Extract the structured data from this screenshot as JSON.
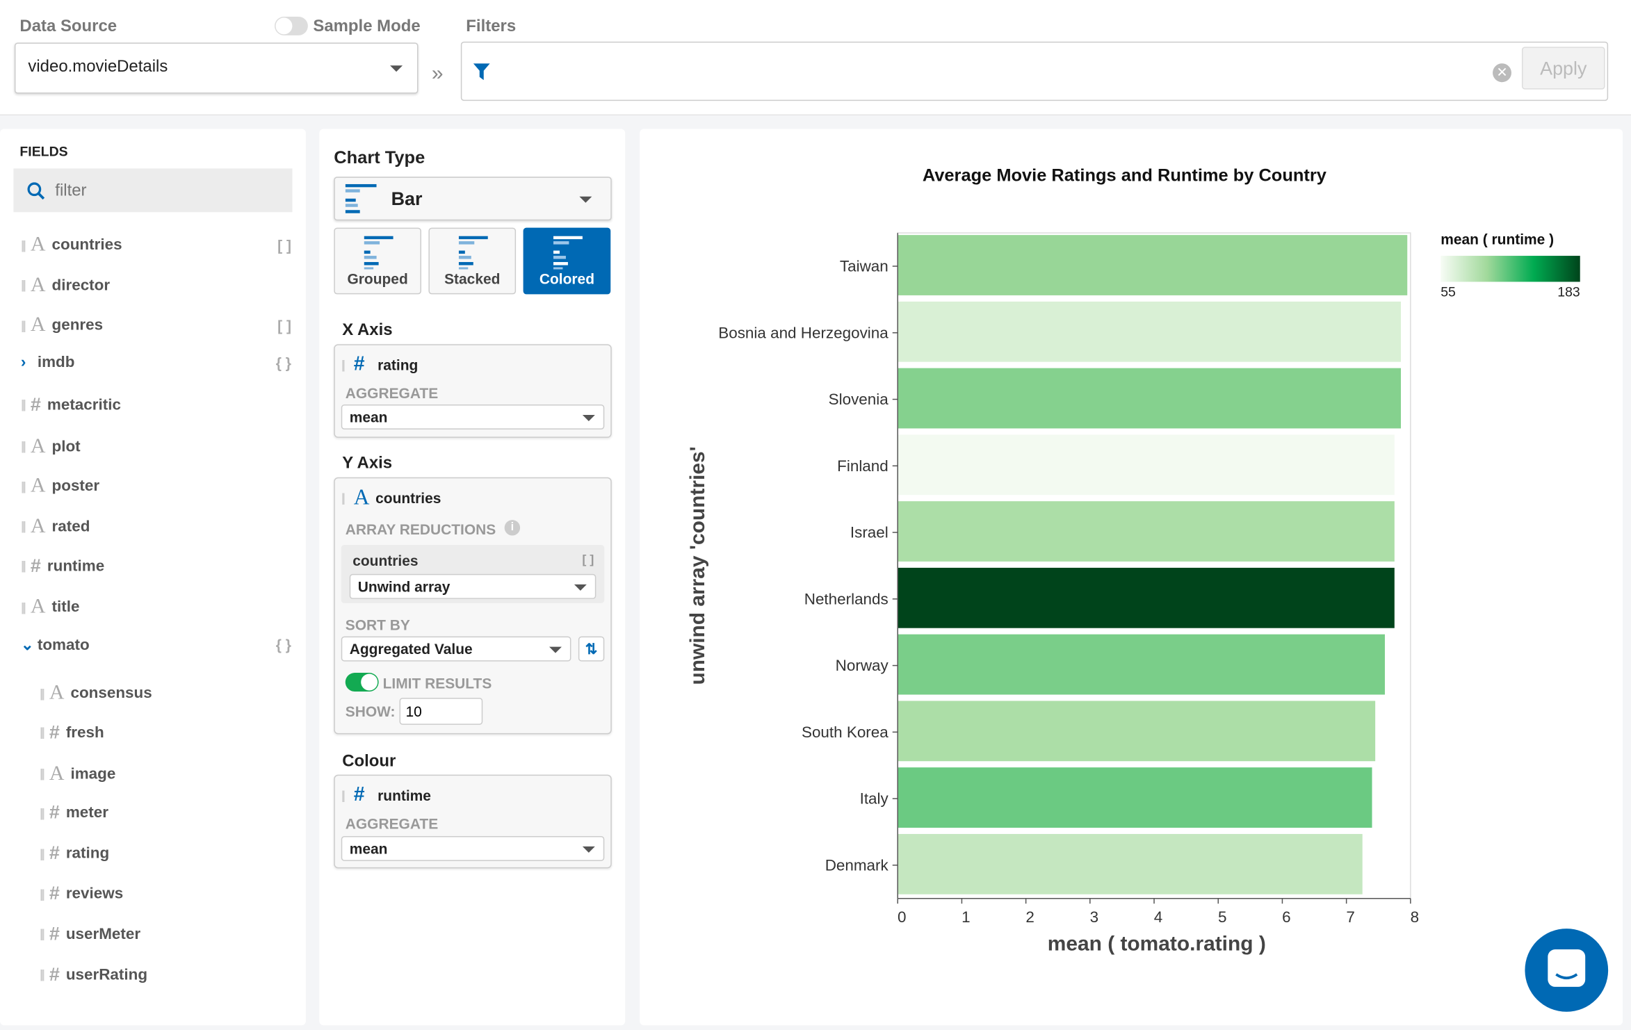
{
  "topbar": {
    "data_source_label": "Data Source",
    "sample_mode_label": "Sample Mode",
    "sample_mode_on": false,
    "data_source_value": "video.movieDetails",
    "filters_label": "Filters",
    "filter_value": "",
    "apply_label": "Apply"
  },
  "fields": {
    "title": "FIELDS",
    "filter_placeholder": "filter",
    "items": [
      {
        "name": "countries",
        "type": "string",
        "suffix": "[ ]"
      },
      {
        "name": "director",
        "type": "string",
        "suffix": ""
      },
      {
        "name": "genres",
        "type": "string",
        "suffix": "[ ]"
      },
      {
        "name": "imdb",
        "type": "object",
        "suffix": "{ }",
        "expand": "›"
      },
      {
        "name": "metacritic",
        "type": "number",
        "suffix": ""
      },
      {
        "name": "plot",
        "type": "string",
        "suffix": ""
      },
      {
        "name": "poster",
        "type": "string",
        "suffix": ""
      },
      {
        "name": "rated",
        "type": "string",
        "suffix": ""
      },
      {
        "name": "runtime",
        "type": "number",
        "suffix": ""
      },
      {
        "name": "title",
        "type": "string",
        "suffix": ""
      },
      {
        "name": "tomato",
        "type": "object",
        "suffix": "{ }",
        "expand": "⌄"
      }
    ],
    "sub_items": [
      {
        "name": "consensus",
        "type": "string"
      },
      {
        "name": "fresh",
        "type": "number"
      },
      {
        "name": "image",
        "type": "string"
      },
      {
        "name": "meter",
        "type": "number"
      },
      {
        "name": "rating",
        "type": "number"
      },
      {
        "name": "reviews",
        "type": "number"
      },
      {
        "name": "userMeter",
        "type": "number"
      },
      {
        "name": "userRating",
        "type": "number"
      }
    ]
  },
  "encoding": {
    "chart_type_label": "Chart Type",
    "chart_type_value": "Bar",
    "subtypes": [
      {
        "label": "Grouped",
        "active": false
      },
      {
        "label": "Stacked",
        "active": false
      },
      {
        "label": "Colored",
        "active": true
      }
    ],
    "x_axis": {
      "label": "X Axis",
      "field": "rating",
      "aggregate_label": "AGGREGATE",
      "aggregate": "mean"
    },
    "y_axis": {
      "label": "Y Axis",
      "field": "countries",
      "array_reductions_label": "ARRAY REDUCTIONS",
      "reduction_field": "countries",
      "reduction": "Unwind array",
      "sort_by_label": "SORT BY",
      "sort_by": "Aggregated Value",
      "limit_label": "LIMIT RESULTS",
      "limit_on": true,
      "show_label": "SHOW:",
      "show_value": "10"
    },
    "colour": {
      "label": "Colour",
      "field": "runtime",
      "aggregate_label": "AGGREGATE",
      "aggregate": "mean"
    }
  },
  "colors": {
    "accent": "#0069b4",
    "toggle_on": "#13aa52"
  },
  "chart_data": {
    "type": "bar",
    "orientation": "horizontal",
    "title": "Average Movie Ratings and Runtime by Country",
    "xlabel": "mean ( tomato.rating )",
    "ylabel": "unwind array 'countries'",
    "xlim": [
      0,
      8
    ],
    "xticks": [
      0,
      1,
      2,
      3,
      4,
      5,
      6,
      7,
      8
    ],
    "categories": [
      "Taiwan",
      "Bosnia and Herzegovina",
      "Slovenia",
      "Finland",
      "Israel",
      "Netherlands",
      "Norway",
      "South Korea",
      "Italy",
      "Denmark"
    ],
    "values": [
      7.95,
      7.85,
      7.85,
      7.75,
      7.75,
      7.75,
      7.6,
      7.45,
      7.4,
      7.25
    ],
    "color_values": [
      100,
      70,
      105,
      57,
      92,
      183,
      108,
      92,
      112,
      80
    ],
    "legend": {
      "title": "mean ( runtime )",
      "min": "55",
      "max": "183",
      "placement": "right",
      "colors": [
        "#f7fcf5",
        "#a1d99b",
        "#00ab51",
        "#00441b"
      ]
    }
  }
}
